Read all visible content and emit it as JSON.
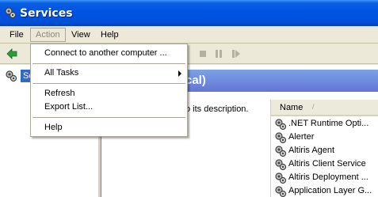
{
  "window": {
    "title": "Services"
  },
  "menubar": {
    "items": [
      "File",
      "Action",
      "View",
      "Help"
    ],
    "open_item": "Action"
  },
  "action_menu": {
    "items": [
      {
        "label": "Connect to another computer ..."
      },
      {
        "label": "All Tasks",
        "submenu": true
      },
      {
        "label": "Refresh"
      },
      {
        "label": "Export List..."
      },
      {
        "label": "Help"
      }
    ]
  },
  "tree": {
    "selected_label": "Se"
  },
  "right_pane": {
    "header_fragment": "cal)",
    "description_fragment": "o its description."
  },
  "services_list": {
    "column_header": "Name",
    "sort_indicator": "/",
    "rows": [
      ".NET Runtime Opti...",
      "Alerter",
      "Altiris Agent",
      "Altiris Client Service",
      "Altiris Deployment ...",
      "Application Layer G..."
    ]
  },
  "colors": {
    "titlebar": "#0054e3",
    "selection": "#316ac5",
    "pane_header": "#6375d6"
  }
}
